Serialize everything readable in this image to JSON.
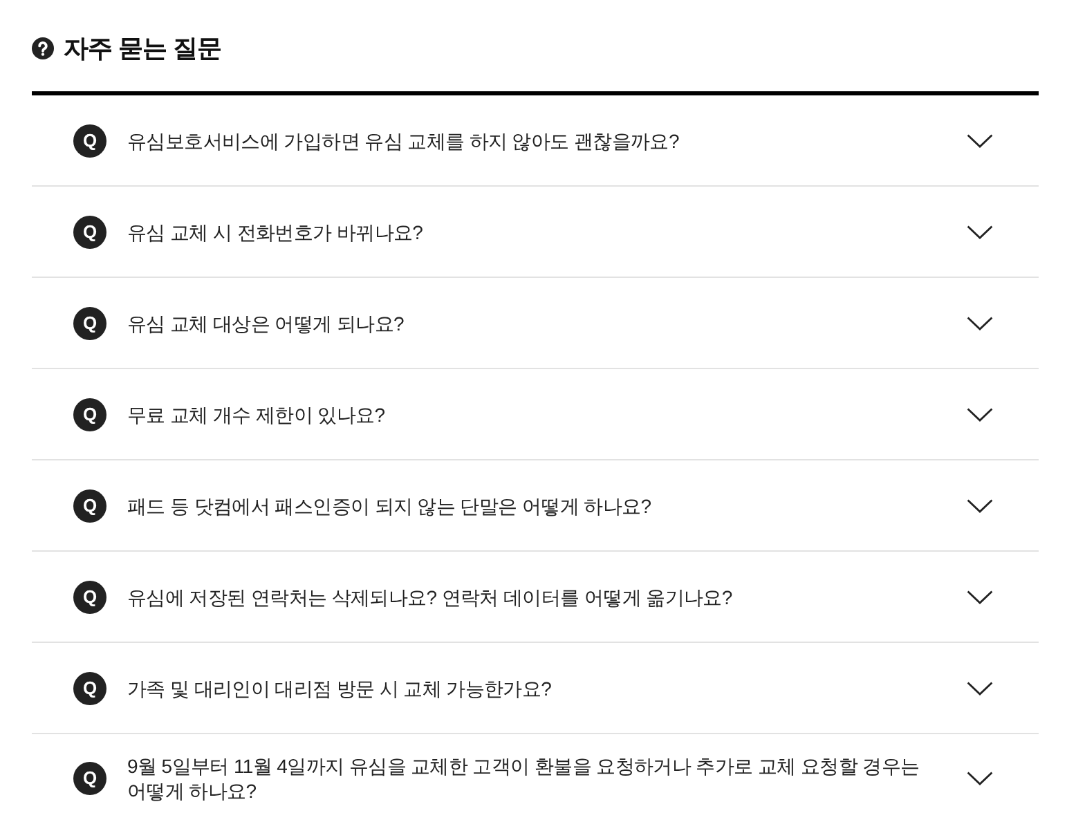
{
  "heading": {
    "title": "자주 묻는 질문"
  },
  "items": [
    {
      "badge": "Q",
      "question": "유심보호서비스에 가입하면 유심 교체를 하지 않아도 괜찮을까요?",
      "expanded": false
    },
    {
      "badge": "Q",
      "question": "유심 교체 시 전화번호가 바뀌나요?",
      "expanded": false
    },
    {
      "badge": "Q",
      "question": "유심 교체 대상은 어떻게 되나요?",
      "expanded": false
    },
    {
      "badge": "Q",
      "question": "무료 교체 개수 제한이 있나요?",
      "expanded": false
    },
    {
      "badge": "Q",
      "question": "패드 등 닷컴에서 패스인증이 되지 않는 단말은 어떻게 하나요?",
      "expanded": false
    },
    {
      "badge": "Q",
      "question": "유심에 저장된 연락처는 삭제되나요? 연락처 데이터를 어떻게 옮기나요?",
      "expanded": false
    },
    {
      "badge": "Q",
      "question": "가족 및 대리인이 대리점 방문 시 교체 가능한가요?",
      "expanded": false
    },
    {
      "badge": "Q",
      "question": "9월 5일부터 11월 4일까지 유심을 교체한 고객이 환불을 요청하거나 추가로 교체 요청할 경우는 어떻게 하나요?",
      "expanded": false
    }
  ]
}
